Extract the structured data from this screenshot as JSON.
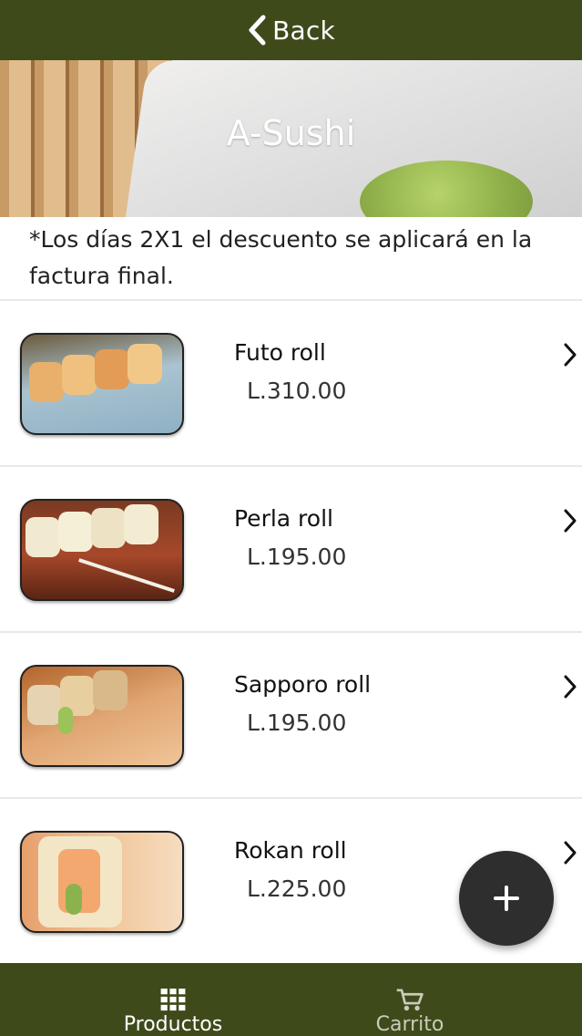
{
  "header": {
    "back_label": "Back"
  },
  "hero": {
    "title": "A-Sushi"
  },
  "notice": "*Los días 2X1 el descuento se aplicará en la factura final.",
  "products": [
    {
      "name": "Futo roll",
      "price": "L.310.00"
    },
    {
      "name": "Perla roll",
      "price": "L.195.00"
    },
    {
      "name": "Sapporo roll",
      "price": "L.195.00"
    },
    {
      "name": "Rokan roll",
      "price": "L.225.00"
    }
  ],
  "fab": {
    "icon": "plus-icon"
  },
  "bottom_nav": {
    "tabs": [
      {
        "label": "Productos",
        "icon": "grid-icon",
        "active": true
      },
      {
        "label": "Carrito",
        "icon": "cart-icon",
        "active": false
      }
    ]
  },
  "colors": {
    "bar": "#3f4a1b",
    "fab": "#2e2e2e"
  }
}
